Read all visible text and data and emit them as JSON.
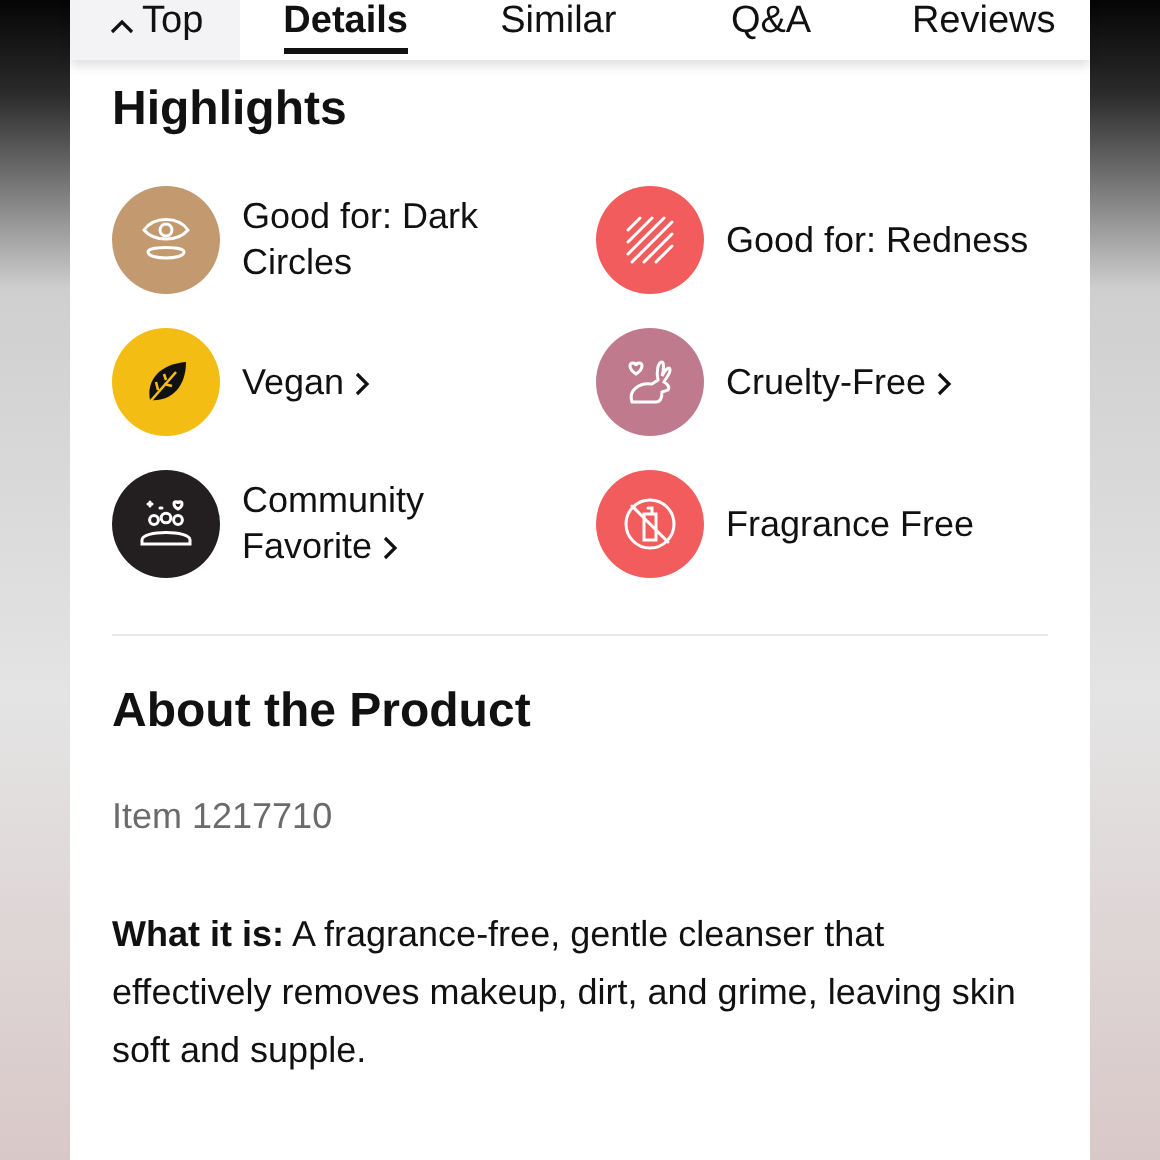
{
  "tabs": [
    {
      "label": "Top",
      "kind": "back",
      "selected": false
    },
    {
      "label": "Details",
      "kind": "tab",
      "selected": true
    },
    {
      "label": "Similar",
      "kind": "tab",
      "selected": false
    },
    {
      "label": "Q&A",
      "kind": "tab",
      "selected": false
    },
    {
      "label": "Reviews",
      "kind": "tab",
      "selected": false
    }
  ],
  "highlights": {
    "title": "Highlights",
    "items": [
      {
        "label": "Good for: Dark Circles",
        "kind": "eye",
        "color": "#c39a70",
        "link": false
      },
      {
        "label": "Good for: Redness",
        "kind": "stripes",
        "color": "#f25c5c",
        "link": false
      },
      {
        "label": "Vegan",
        "kind": "leaf",
        "color": "#f3bd14",
        "link": true
      },
      {
        "label": "Cruelty-Free",
        "kind": "rabbit",
        "color": "#c07a8e",
        "link": true
      },
      {
        "label": "Community Favorite",
        "kind": "people",
        "color": "#231f20",
        "link": true
      },
      {
        "label": "Fragrance Free",
        "kind": "nospray",
        "color": "#f25c5c",
        "link": false
      }
    ]
  },
  "about": {
    "title": "About the Product",
    "item": "Item 1217710",
    "description": "**What it is:** A fragrance-free, gentle cleanser that effectively removes makeup, dirt, and grime, leaving skin soft and supple."
  }
}
